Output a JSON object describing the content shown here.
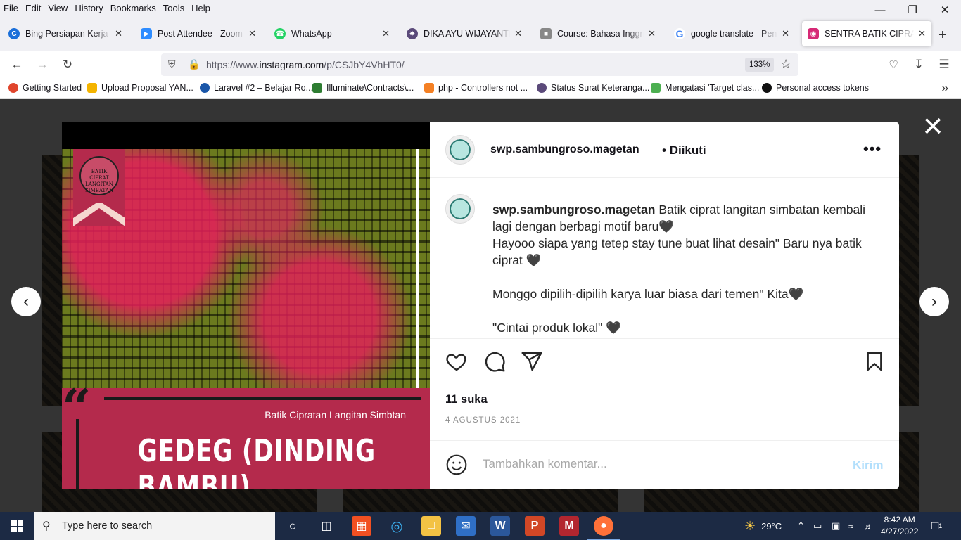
{
  "menubar": {
    "items": [
      "File",
      "Edit",
      "View",
      "History",
      "Bookmarks",
      "Tools",
      "Help"
    ]
  },
  "tabs": [
    {
      "label": "Bing Persiapan Kerja - Pr",
      "icon": "bing-icon",
      "color": "#1b6fd9",
      "active": false
    },
    {
      "label": "Post Attendee - Zoom",
      "icon": "zoom-icon",
      "color": "#2d8cff",
      "active": false
    },
    {
      "label": "WhatsApp",
      "icon": "whatsapp-icon",
      "color": "#25d366",
      "active": false
    },
    {
      "label": "DIKA AYU WIJAYANTI | Sp",
      "icon": "university-icon",
      "color": "#5b4a7a",
      "active": false
    },
    {
      "label": "Course: Bahasa Inggris Pe",
      "icon": "course-icon",
      "color": "#888888",
      "active": false
    },
    {
      "label": "google translate - Penelu",
      "icon": "google-icon",
      "color": "#4285f4",
      "active": false
    },
    {
      "label": "SENTRA BATIK CIPRAT",
      "icon": "instagram-icon",
      "color": "#d62976",
      "active": true
    }
  ],
  "nav": {
    "url_prefix": "https://www.",
    "url_host": "instagram.com",
    "url_path": "/p/CSJbY4VhHT0/",
    "zoom": "133%"
  },
  "bookmarks": [
    {
      "label": "Getting Started",
      "color": "#e0452c"
    },
    {
      "label": "Upload Proposal YAN...",
      "color": "#f4b400"
    },
    {
      "label": "Laravel #2 – Belajar Ro...",
      "color": "#1a56a8"
    },
    {
      "label": "Illuminate\\Contracts\\...",
      "color": "#2e7d32"
    },
    {
      "label": "php - Controllers not ...",
      "color": "#f48024"
    },
    {
      "label": "Status Surat Keteranga...",
      "color": "#5b4a7a"
    },
    {
      "label": "Mengatasi 'Target clas...",
      "color": "#4caf50"
    },
    {
      "label": "Personal access tokens",
      "color": "#111111"
    }
  ],
  "post": {
    "image": {
      "logo_text": "BATIK CIPRAT LANGITAN SIMBATAN",
      "subtitle": "Batik Cipratan Langitan Simbtan",
      "title": "GEDEG (DINDING BAMBU)"
    },
    "username": "swp.sambungroso.magetan",
    "follow_label": "Diikuti",
    "more_label": "•••",
    "caption_lines": [
      "Batik ciprat langitan simbatan kembali",
      "lagi dengan berbagi motif baru🖤",
      "Hayooo siapa yang tetep stay tune buat lihat desain\" Baru nya batik",
      "ciprat 🖤",
      "",
      "Monggo dipilih-dipilih karya luar biasa dari temen\" Kita🖤",
      "",
      "\"Cintai produk lokal\" 🖤"
    ],
    "likes": "11 suka",
    "date": "4 AGUSTUS 2021",
    "comment_placeholder": "Tambahkan komentar...",
    "send_label": "Kirim"
  },
  "taskbar": {
    "search_placeholder": "Type here to search",
    "weather": "29°C",
    "time": "8:42 AM",
    "date": "4/27/2022",
    "notifications": "1"
  }
}
